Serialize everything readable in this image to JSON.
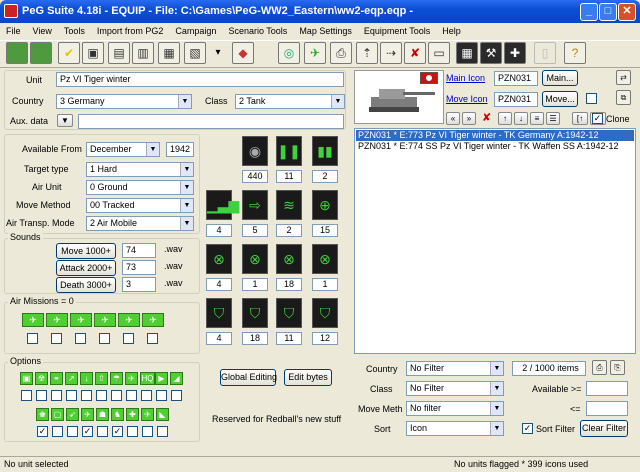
{
  "window": {
    "title": "PeG Suite 4.18i  -  EQUIP  -  File: C:\\Games\\PeG-WW2_Eastern\\ww2-eqp.eqp  -",
    "minimize": "_",
    "maximize": "□",
    "close": "✕"
  },
  "menu": [
    "File",
    "View",
    "Tools",
    "Import from PG2",
    "Campaign",
    "Scenario Tools",
    "Map Settings",
    "Equipment Tools",
    "Help"
  ],
  "toolbar": [
    {
      "name": "new",
      "glyph": "✎",
      "style": "",
      "color": "#4f9a3e"
    },
    {
      "name": "check-green",
      "glyph": "✔",
      "style": "",
      "color": "#4f9a3e"
    },
    {
      "name": "check-yellow",
      "glyph": "✔",
      "style": "light",
      "color": "#e3c200"
    },
    {
      "name": "save",
      "glyph": "▣",
      "style": "light",
      "color": "#333"
    },
    {
      "name": "save-as",
      "glyph": "▤",
      "style": "light",
      "color": "#333"
    },
    {
      "name": "export",
      "glyph": "▥",
      "style": "light",
      "color": "#333"
    },
    {
      "name": "file-a",
      "glyph": "▦",
      "style": "light",
      "color": "#333"
    },
    {
      "name": "file-b",
      "glyph": "▧",
      "style": "light",
      "color": "#333"
    },
    {
      "name": "tank-tool",
      "glyph": "◆",
      "style": "light",
      "color": "#c33"
    },
    {
      "name": "color",
      "glyph": "◎",
      "style": "light",
      "color": "#1a6"
    },
    {
      "name": "unit",
      "glyph": "✈",
      "style": "light",
      "color": "#2a2"
    },
    {
      "name": "print",
      "glyph": "⎙",
      "style": "light",
      "color": "#333"
    },
    {
      "name": "move-up",
      "glyph": "⇡",
      "style": "light",
      "color": "#333"
    },
    {
      "name": "move",
      "glyph": "⇢",
      "style": "light",
      "color": "#333"
    },
    {
      "name": "delete",
      "glyph": "✘",
      "style": "light",
      "color": "#c00"
    },
    {
      "name": "screen",
      "glyph": "▭",
      "style": "light",
      "color": "#333"
    },
    {
      "name": "calculator",
      "glyph": "▦",
      "style": "dark",
      "color": "#fff"
    },
    {
      "name": "tools",
      "glyph": "⚒",
      "style": "dark",
      "color": "#fff"
    },
    {
      "name": "cross",
      "glyph": "✚",
      "style": "dark",
      "color": "#fff"
    },
    {
      "name": "disabled",
      "glyph": "▯",
      "style": "off",
      "color": "#bbb"
    },
    {
      "name": "help",
      "glyph": "?",
      "style": "light",
      "color": "#b8860b"
    }
  ],
  "unit": {
    "label": "Unit",
    "value": "Pz VI Tiger winter",
    "country_label": "Country",
    "country": "3  Germany",
    "class_label": "Class",
    "class": "2  Tank",
    "aux_label": "Aux. data",
    "aux": ""
  },
  "fields": {
    "available_from_label": "Available From",
    "available_month": "December",
    "available_year": "1942",
    "target_type_label": "Target type",
    "target_type": "1  Hard",
    "air_unit_label": "Air Unit",
    "air_unit": "0  Ground",
    "move_method_label": "Move  Method",
    "move_method": "00 Tracked",
    "air_transp_label": "Air Transp. Mode",
    "air_transp": "2  Air Mobile"
  },
  "sounds": {
    "title": "Sounds",
    "items": [
      {
        "label": "Move 1000+",
        "value": "74",
        "ext": ".wav"
      },
      {
        "label": "Attack 2000+",
        "value": "73",
        "ext": ".wav"
      },
      {
        "label": "Death  3000+",
        "value": "3",
        "ext": ".wav"
      }
    ]
  },
  "stats": [
    {
      "icon": "cost-coin",
      "glyph": "◉",
      "tone": "gr",
      "value": "440"
    },
    {
      "icon": "ammo",
      "glyph": "❚❚",
      "tone": "g",
      "value": "11"
    },
    {
      "icon": "fuel",
      "glyph": "▮▮",
      "tone": "g",
      "value": "2"
    },
    {
      "icon": "strength",
      "glyph": "▁▃▆",
      "tone": "g",
      "value": "4"
    },
    {
      "icon": "movement",
      "glyph": "⇨",
      "tone": "g",
      "value": "5"
    },
    {
      "icon": "initiative",
      "glyph": "≋",
      "tone": "g",
      "value": "2"
    },
    {
      "icon": "spotting",
      "glyph": "⊕",
      "tone": "g",
      "value": "15"
    },
    {
      "icon": "soft-attack",
      "glyph": "⊗",
      "tone": "g",
      "value": "4"
    },
    {
      "icon": "hard-attack",
      "glyph": "⊗",
      "tone": "g",
      "value": "1"
    },
    {
      "icon": "air-attack",
      "glyph": "⊗",
      "tone": "g",
      "value": "18"
    },
    {
      "icon": "naval-attack",
      "glyph": "⊗",
      "tone": "g",
      "value": "1"
    },
    {
      "icon": "range",
      "glyph": "⛉",
      "tone": "g",
      "value": "4"
    },
    {
      "icon": "ground-defense",
      "glyph": "⛉",
      "tone": "g",
      "value": "18"
    },
    {
      "icon": "air-defense",
      "glyph": "⛉",
      "tone": "g",
      "value": "11"
    },
    {
      "icon": "close-defense",
      "glyph": "⛉",
      "tone": "g",
      "value": "12"
    }
  ],
  "air_missions": {
    "title": "Air Missions = 0",
    "icons": [
      "✈",
      "✈",
      "✈",
      "✈",
      "✈",
      "✈"
    ]
  },
  "options": {
    "title": "Options",
    "row1": [
      "▣",
      "☢",
      "⚭",
      "↗",
      "↓",
      "⇧",
      "☂",
      "✈",
      "HQ",
      "▶",
      "◢"
    ],
    "row2": [
      "♚",
      "▢",
      "➹",
      "✈",
      "☗",
      "♞",
      "✚",
      "✈",
      "◣"
    ],
    "row2_checked": [
      true,
      false,
      false,
      true,
      false,
      true,
      false,
      false,
      false
    ]
  },
  "buttons": {
    "global_editing": "Global Editing",
    "edit_bytes": "Edit bytes",
    "reserved": "Reserved for Redball's new stuff"
  },
  "icons_panel": {
    "main_icon_label": "Main Icon",
    "main_icon": "PZN031",
    "main_btn": "Main...",
    "move_icon_label": "Move Icon",
    "move_icon": "PZN031",
    "move_btn": "Move...",
    "clone_label": "Clone",
    "clone_checked": true
  },
  "list": {
    "items": [
      "PZN031  * E:773  Pz VI Tiger winter -  TK Germany  A:1942-12",
      "PZN031  * E:774  SS Pz VI Tiger winter -  TK Waffen SS  A:1942-12"
    ],
    "selected": 0
  },
  "filters": {
    "country_label": "Country",
    "country": "No Filter",
    "count": "2 / 1000 items",
    "class_label": "Class",
    "class": "No Filter",
    "available_label": "Available >=",
    "available": "",
    "move_label": "Move Meth",
    "move": "No filter",
    "lte_label": "<=",
    "lte": "",
    "sort_label": "Sort",
    "sort": "Icon",
    "sort_filter_label": "Sort Filter",
    "sort_filter_checked": true,
    "clear_filter": "Clear Filter"
  },
  "status": {
    "left": "No unit selected",
    "right": "No units flagged * 399 icons used"
  }
}
